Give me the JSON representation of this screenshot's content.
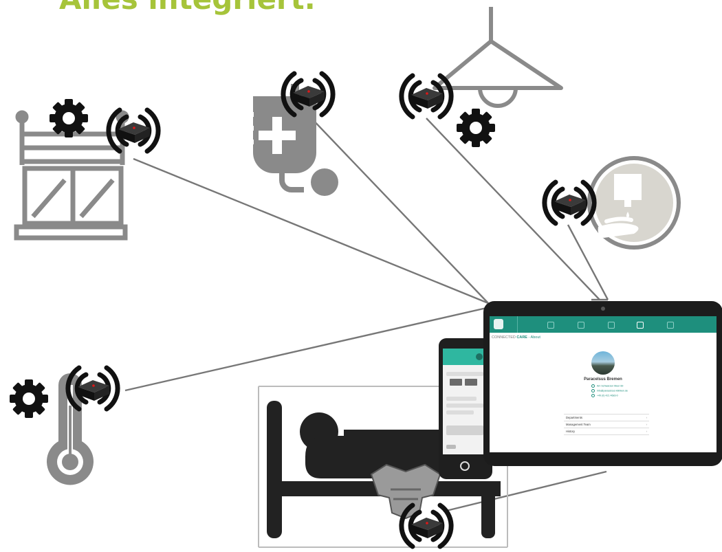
{
  "headline": "Alles integriert.",
  "tablet": {
    "brand_prefix": "CONNECTED ",
    "brand_strong": "CARE",
    "breadcrumb_page": " - About",
    "profile_name": "Paracelsus Bremen",
    "address": "Am Schwarzen Meer 89",
    "email": "info@paracelsus-kliniken.de",
    "phone": "+49 (0) 421 4683-0",
    "list_items": [
      "Departments",
      "Management Team",
      "History"
    ],
    "chevron": "›"
  }
}
